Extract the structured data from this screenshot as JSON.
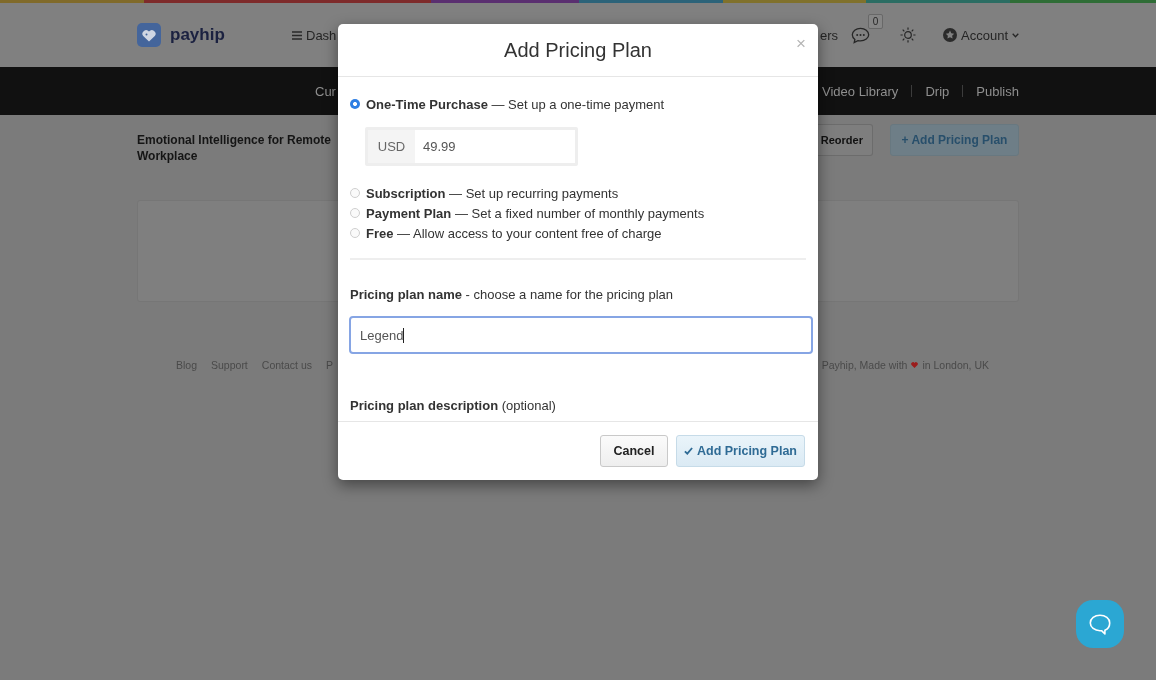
{
  "header": {
    "logo": "payhip",
    "menu_link": "Dash",
    "right_link": "ers",
    "notification_count": "0",
    "account": "Account"
  },
  "subnav": {
    "left_links": [
      "Cur"
    ],
    "right_links": [
      "Video Library",
      "Drip",
      "Publish"
    ]
  },
  "product": {
    "title": "Emotional Intelligence for Remote\nWorkplace",
    "buttons": [
      {
        "label": "Reorder",
        "kind": "default"
      },
      {
        "label": "+ Add Pricing Plan",
        "kind": "primary"
      }
    ]
  },
  "footer": {
    "links": [
      "Blog",
      "Support",
      "Contact us",
      "P"
    ],
    "credit_before": "Payhip, Made with",
    "credit_after": "in London, UK"
  },
  "modal": {
    "title": "Add Pricing Plan",
    "close": "×",
    "options": [
      {
        "label": "**One-Time Purchase** — Set up a one-time payment",
        "selected": true,
        "price": {
          "currency": "USD",
          "value": "49.99"
        }
      },
      {
        "label": "**Subscription** — Set up recurring payments",
        "selected": false
      },
      {
        "label": "**Payment Plan** — Set a fixed number of monthly payments",
        "selected": false
      },
      {
        "label": "**Free** — Allow access to your content free of charge",
        "selected": false
      }
    ],
    "name_field": {
      "label": "**Pricing plan name** - choose a name for the pricing plan",
      "value": "Legend",
      "focused": true
    },
    "description_label": "**Pricing plan description** (optional)",
    "buttons": [
      {
        "label": "Cancel",
        "kind": "secondary"
      },
      {
        "label": "Add Pricing Plan",
        "kind": "primary"
      }
    ]
  }
}
